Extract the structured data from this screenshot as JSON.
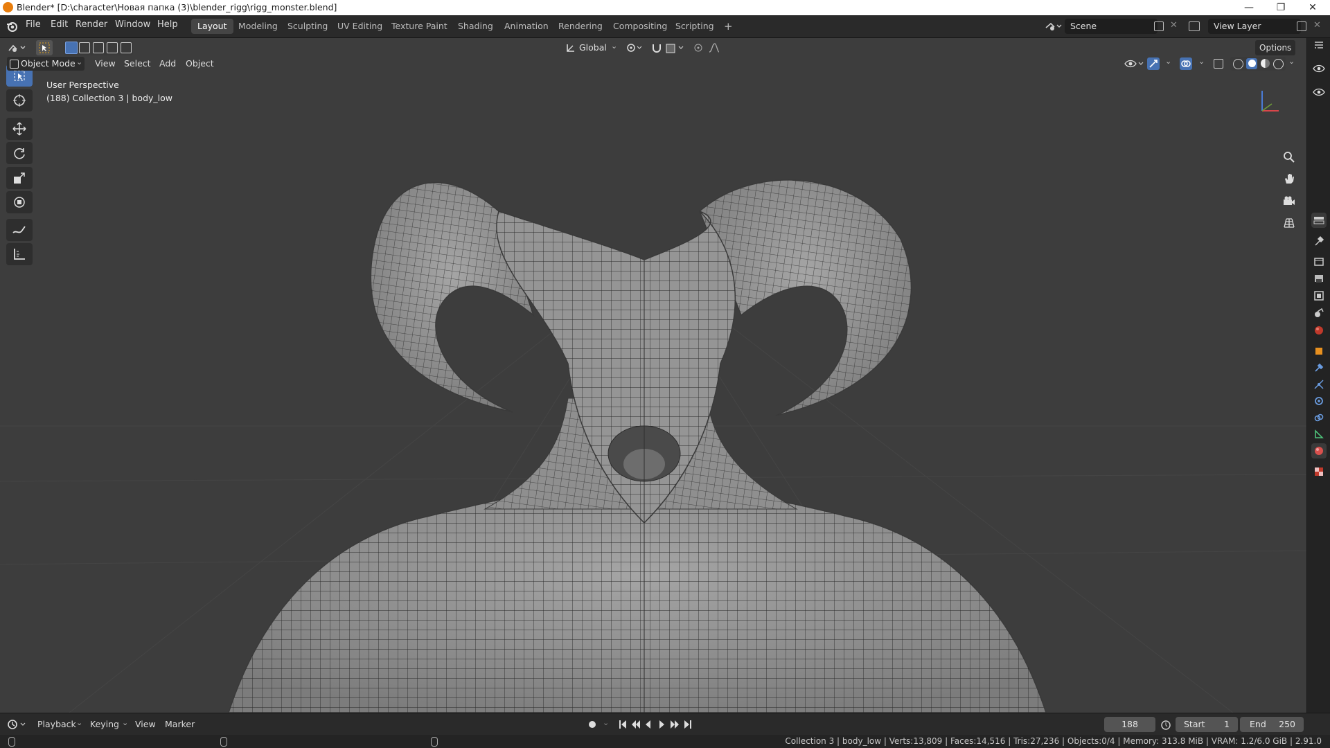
{
  "window": {
    "title": "Blender* [D:\\character\\Новая папка (3)\\blender_rigg\\rigg_monster.blend]",
    "minimize": "—",
    "maximize": "❐",
    "close": "✕"
  },
  "menu": [
    "File",
    "Edit",
    "Render",
    "Window",
    "Help"
  ],
  "workspaces": [
    "Layout",
    "Modeling",
    "Sculpting",
    "UV Editing",
    "Texture Paint",
    "Shading",
    "Animation",
    "Rendering",
    "Compositing",
    "Scripting"
  ],
  "active_workspace": "Layout",
  "add_workspace": "+",
  "scene": {
    "name": "Scene"
  },
  "view_layer": {
    "name": "View Layer"
  },
  "header": {
    "orientation": "Global",
    "options_label": "Options"
  },
  "viewport_header": {
    "mode": "Object Mode",
    "menus": [
      "View",
      "Select",
      "Add",
      "Object"
    ]
  },
  "overlay": {
    "perspective": "User Perspective",
    "collection": "(188) Collection 3 | body_low"
  },
  "tools": [
    "select-box",
    "cursor",
    "move",
    "rotate",
    "scale",
    "transform",
    "annotate",
    "measure"
  ],
  "timeline": {
    "menus": [
      "Playback",
      "Keying",
      "View",
      "Marker"
    ],
    "current_frame": "188",
    "start_label": "Start",
    "start": "1",
    "end_label": "End",
    "end": "250"
  },
  "status": "Collection 3 | body_low | Verts:13,809 | Faces:14,516 | Tris:27,236 | Objects:0/4 | Memory: 313.8 MiB | VRAM: 1.2/6.0 GiB | 2.91.0",
  "colors": {
    "accent": "#4772b3",
    "viewport_bg": "#3d3d3d",
    "mesh": "#8d8d8d"
  }
}
